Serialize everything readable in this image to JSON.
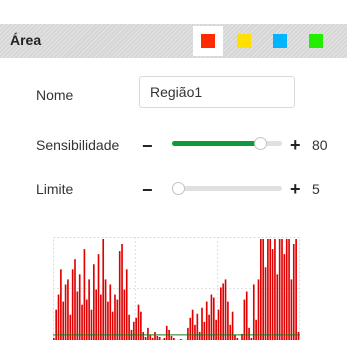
{
  "area": {
    "title": "Área",
    "colors": [
      {
        "name": "red",
        "hex": "#ff2a00",
        "selected": true
      },
      {
        "name": "yellow",
        "hex": "#ffe000",
        "selected": false
      },
      {
        "name": "cyan",
        "hex": "#00b4ff",
        "selected": false
      },
      {
        "name": "green",
        "hex": "#22ee00",
        "selected": false
      }
    ]
  },
  "form": {
    "name_label": "Nome",
    "name_value": "Região1",
    "sensitivity_label": "Sensibilidade",
    "sensitivity_value": "80",
    "limit_label": "Limite",
    "limit_value": "5",
    "minus": "−",
    "plus": "+"
  },
  "sliders": {
    "sensitivity": {
      "value": 80,
      "min": 0,
      "max": 100
    },
    "limit": {
      "value": 5,
      "min": 0,
      "max": 100
    }
  },
  "chart_data": {
    "type": "bar",
    "bar_color": "#e00000",
    "threshold_line_color": "#1a7a1a",
    "grid": true,
    "ylim": [
      0,
      100
    ],
    "values": [
      2,
      30,
      45,
      70,
      38,
      55,
      60,
      25,
      70,
      80,
      48,
      65,
      35,
      90,
      40,
      60,
      30,
      75,
      50,
      85,
      45,
      100,
      60,
      38,
      55,
      28,
      45,
      40,
      88,
      95,
      50,
      70,
      25,
      10,
      18,
      22,
      35,
      28,
      8,
      3,
      12,
      5,
      2,
      8,
      4,
      3,
      0,
      2,
      14,
      10,
      4,
      2,
      0,
      0,
      1,
      0,
      0,
      12,
      22,
      30,
      15,
      26,
      8,
      32,
      18,
      38,
      25,
      45,
      42,
      20,
      30,
      52,
      56,
      60,
      38,
      15,
      28,
      5,
      2,
      0,
      6,
      40,
      48,
      12,
      2,
      55,
      20,
      60,
      100,
      100,
      72,
      100,
      100,
      90,
      100,
      65,
      100,
      100,
      85,
      100,
      100,
      60,
      95,
      100,
      8
    ]
  }
}
